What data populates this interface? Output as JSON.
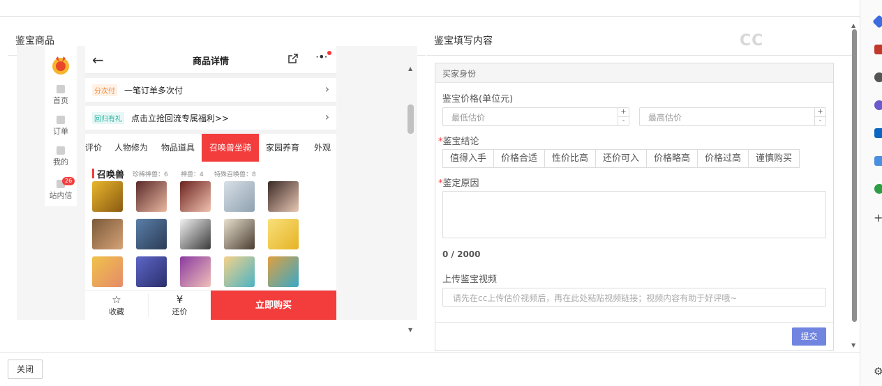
{
  "left_panel": {
    "title": "鉴宝商品"
  },
  "right_panel": {
    "title": "鉴宝填写内容"
  },
  "watermark": "CC",
  "mini_nav": {
    "items": [
      {
        "label": "首页"
      },
      {
        "label": "订单"
      },
      {
        "label": "我的"
      },
      {
        "label": "站内信",
        "badge": "26"
      }
    ]
  },
  "phone": {
    "header_title": "商品详情",
    "promo1": {
      "tag": "分次付",
      "text": "一笔订单多次付"
    },
    "promo2": {
      "tag": "回归有礼",
      "text": "点击立抢回流专属福利>>"
    },
    "tabs": [
      "评价",
      "人物修为",
      "物品道具",
      "召唤兽坐骑",
      "家园养育",
      "外观"
    ],
    "active_tab": "召唤兽坐骑",
    "section": {
      "title": "召唤兽",
      "stats": [
        "珍稀神兽：6",
        "神兽：4",
        "特殊召唤兽：8"
      ]
    },
    "bottom": {
      "favorite": "收藏",
      "bargain": "还价",
      "buy": "立即购买"
    }
  },
  "form": {
    "section_title": "买家身份",
    "price_label": "鉴宝价格(单位元)",
    "min_placeholder": "最低估价",
    "max_placeholder": "最高估价",
    "conclusion_label": "鉴宝结论",
    "conclusions": [
      "值得入手",
      "价格合适",
      "性价比高",
      "还价可入",
      "价格略高",
      "价格过高",
      "谨慎购买"
    ],
    "reason_label": "鉴定原因",
    "counter": "0 / 2000",
    "video_label": "上传鉴宝视频",
    "video_placeholder": "请先在cc上传估价视频后，再在此处粘贴视频链接；视频内容有助于好评哦~",
    "submit": "提交"
  },
  "footer": {
    "close": "关闭"
  },
  "colors": {
    "accent_red": "#f33c3c",
    "submit_blue": "#7084e0"
  }
}
